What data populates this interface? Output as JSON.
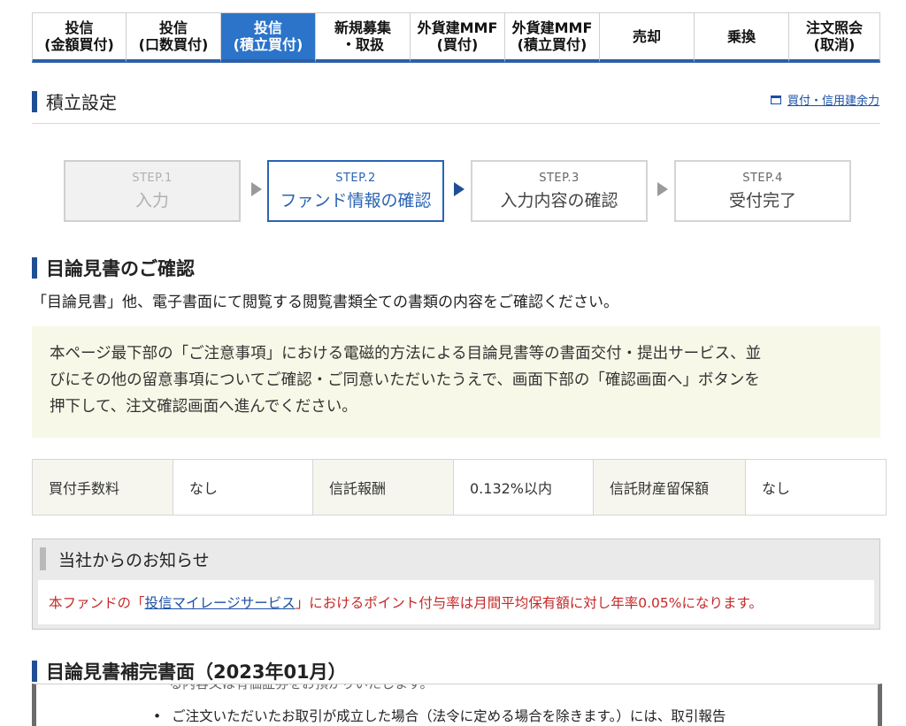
{
  "tabs": [
    {
      "label": "投信\n(金額買付)",
      "active": false
    },
    {
      "label": "投信\n(口数買付)",
      "active": false
    },
    {
      "label": "投信\n(積立買付)",
      "active": true
    },
    {
      "label": "新規募集\n・取扱",
      "active": false
    },
    {
      "label": "外貨建MMF\n(買付)",
      "active": false
    },
    {
      "label": "外貨建MMF\n(積立買付)",
      "active": false
    },
    {
      "label": "売却",
      "active": false
    },
    {
      "label": "乗換",
      "active": false
    },
    {
      "label": "注文照会\n(取消)",
      "active": false
    }
  ],
  "page_title": "積立設定",
  "side_link": "買付・信用建余力",
  "steps": [
    {
      "num": "STEP.1",
      "label": "入力"
    },
    {
      "num": "STEP.2",
      "label": "ファンド情報の確認"
    },
    {
      "num": "STEP.3",
      "label": "入力内容の確認"
    },
    {
      "num": "STEP.4",
      "label": "受付完了"
    }
  ],
  "prospectus": {
    "title": "目論見書のご確認",
    "intro": "「目論見書」他、電子書面にて閲覧する閲覧書類全ての書類の内容をご確認ください。",
    "notice_lines": [
      "本ページ最下部の「ご注意事項」における電磁的方法による目論見書等の書面交付・提出サービス、並",
      "びにその他の留意事項についてご確認・ご同意いただいたうえで、画面下部の「確認画面へ」ボタンを",
      "押下して、注文確認画面へ進んでください。"
    ]
  },
  "fees": {
    "purchase_fee_label": "買付手数料",
    "purchase_fee_value": "なし",
    "trust_fee_label": "信託報酬",
    "trust_fee_value": "0.132%以内",
    "reserve_label": "信託財産留保額",
    "reserve_value": "なし"
  },
  "company_notice": {
    "title": "当社からのお知らせ",
    "text_before": "本ファンドの「",
    "link": "投信マイレージサービス",
    "text_after": "」におけるポイント付与率は月間平均保有額に対し年率0.05%になります。"
  },
  "supplement": {
    "title": "目論見書補完書面（2023年01月）",
    "cut_line": "る内容又は有価証券をお預かりいたします。",
    "bullet": "ご注文いただいたお取引が成立した場合（法令に定める場合を除きます。）には、取引報告"
  }
}
